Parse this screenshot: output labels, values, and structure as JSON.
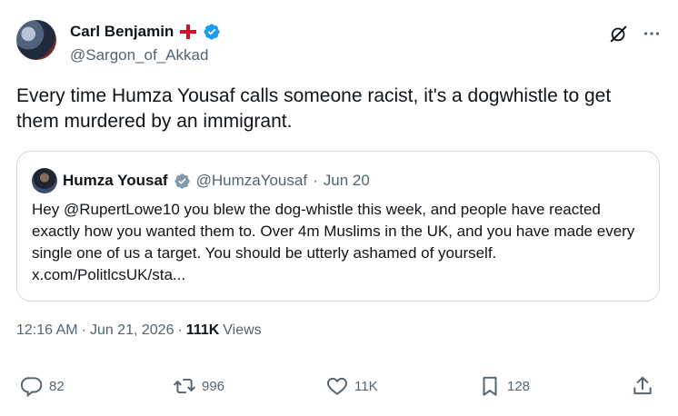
{
  "author": {
    "display_name": "Carl Benjamin",
    "handle": "@Sargon_of_Akkad"
  },
  "tweet": {
    "text": "Every time Humza Yousaf calls someone racist, it's a dogwhistle to get them murdered by an immigrant."
  },
  "quoted": {
    "display_name": "Humza Yousaf",
    "handle": "@HumzaYousaf",
    "separator": "·",
    "date": "Jun 20",
    "text": "Hey @RupertLowe10 you blew the dog-whistle this week, and people have reacted exactly how you wanted them to. Over 4m Muslims in the UK, and you have made every single one of us a target.  You should be utterly ashamed of yourself. x.com/PolitlcsUK/sta..."
  },
  "meta": {
    "time": "12:16 AM",
    "separator": "·",
    "date": "Jun 21, 2026",
    "views_count": "111K",
    "views_label": "Views"
  },
  "actions": {
    "replies": "82",
    "reposts": "996",
    "likes": "11K",
    "bookmarks": "128"
  },
  "icons": {
    "verified": "verified-badge-icon",
    "flag": "england-flag-icon",
    "grok": "grok-icon",
    "more": "more-icon",
    "reply": "reply-icon",
    "repost": "repost-icon",
    "like": "like-icon",
    "bookmark": "bookmark-icon",
    "share": "share-icon"
  },
  "colors": {
    "verified_blue": "#1d9bf0",
    "quote_verified_gray": "#829aab",
    "secondary_text": "#536471",
    "primary_text": "#0f1419",
    "border": "#cfd9de"
  }
}
